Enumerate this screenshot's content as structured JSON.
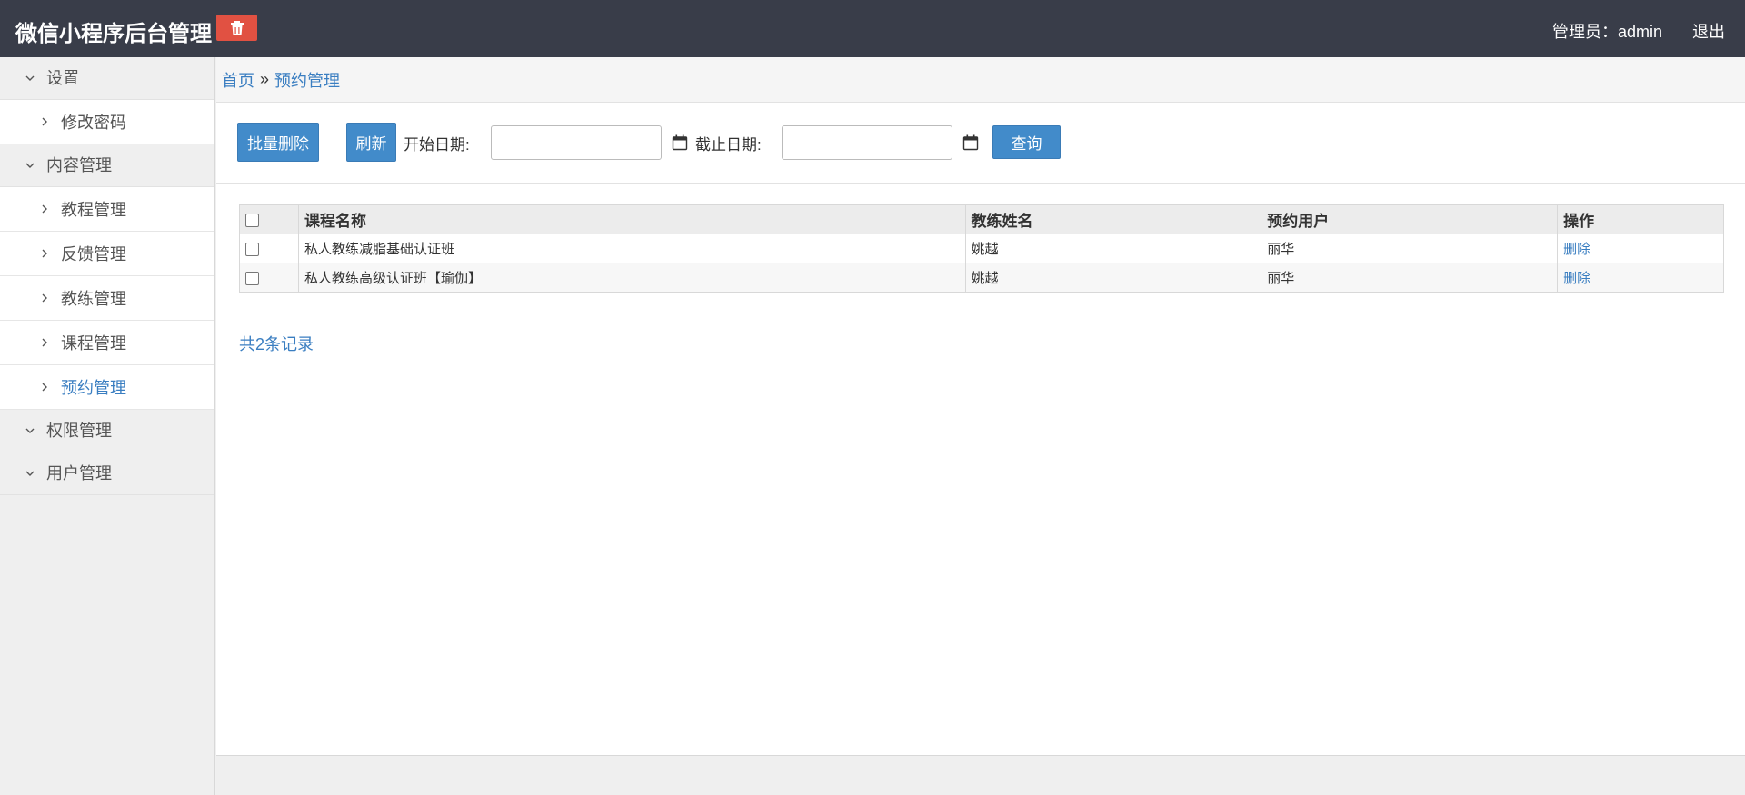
{
  "header": {
    "title": "微信小程序后台管理",
    "admin": "管理员：admin",
    "logout": "退出",
    "trash_icon": "trash-icon",
    "trash_color": "#e15142",
    "bg_color": "#393d49"
  },
  "sidebar": {
    "groups": [
      {
        "label": "设置",
        "items": [
          "修改密码"
        ]
      },
      {
        "label": "内容管理",
        "items": [
          "教程管理",
          "反馈管理",
          "教练管理",
          "课程管理",
          "预约管理"
        ]
      },
      {
        "label": "权限管理",
        "items": []
      },
      {
        "label": "用户管理",
        "items": []
      }
    ],
    "active_item": "预约管理"
  },
  "breadcrumb": {
    "home": "首页",
    "sep": "»",
    "current": "预约管理"
  },
  "toolbar": {
    "batch_delete": "批量删除",
    "refresh": "刷新",
    "start_label": "开始日期:",
    "start_value": "",
    "end_label": "截止日期:",
    "end_value": "",
    "query": "查询"
  },
  "table": {
    "columns": [
      "课程名称",
      "教练姓名",
      "预约用户",
      "操作"
    ],
    "rows": [
      {
        "course": "私人教练减脂基础认证班",
        "coach": "姚越",
        "user": "丽华",
        "action": "删除"
      },
      {
        "course": "私人教练高级认证班【瑜伽】",
        "coach": "姚越",
        "user": "丽华",
        "action": "删除"
      }
    ]
  },
  "total": "共2条记录",
  "accent_color": "#428bca"
}
